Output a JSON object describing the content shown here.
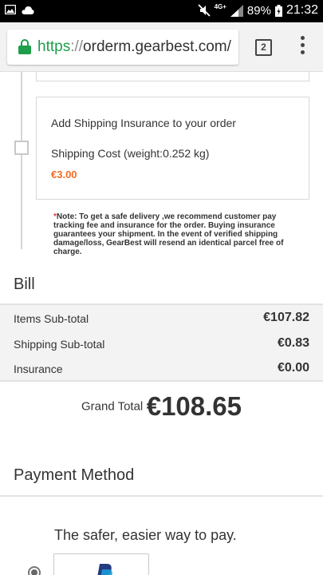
{
  "status_bar": {
    "battery": "89%",
    "network": "4G+",
    "time": "21:32"
  },
  "browser": {
    "url_scheme": "https",
    "url_separator": "://",
    "url_host": "orderm.gearbest.com/",
    "tab_count": "2"
  },
  "insurance": {
    "title": "Add Shipping Insurance to your order",
    "shipping_cost": "Shipping Cost (weight:0.252 kg)",
    "price": "€3.00",
    "note_star": "*",
    "note": "Note: To get a safe delivery ,we recommend customer pay tracking fee and insurance for the order. Buying insurance guarantees your shipment. In the event of verified shipping damage/loss, GearBest will resend an identical parcel free of charge."
  },
  "bill": {
    "title": "Bill",
    "rows": [
      {
        "label": "Items Sub-total",
        "amount": "€107.82"
      },
      {
        "label": "Shipping Sub-total",
        "amount": "€0.83"
      },
      {
        "label": "Insurance",
        "amount": "€0.00"
      }
    ],
    "grand_total_label": "Grand Total",
    "grand_total_value": "€108.65"
  },
  "payment": {
    "title": "Payment Method",
    "tagline": "The safer, easier way to pay.",
    "logo_icon": "paypal-logo-icon"
  },
  "colors": {
    "accent_green": "#1e9e4a",
    "price_orange": "#f36c21",
    "note_red": "#e4393c",
    "paypal_blue": "#253b80"
  }
}
